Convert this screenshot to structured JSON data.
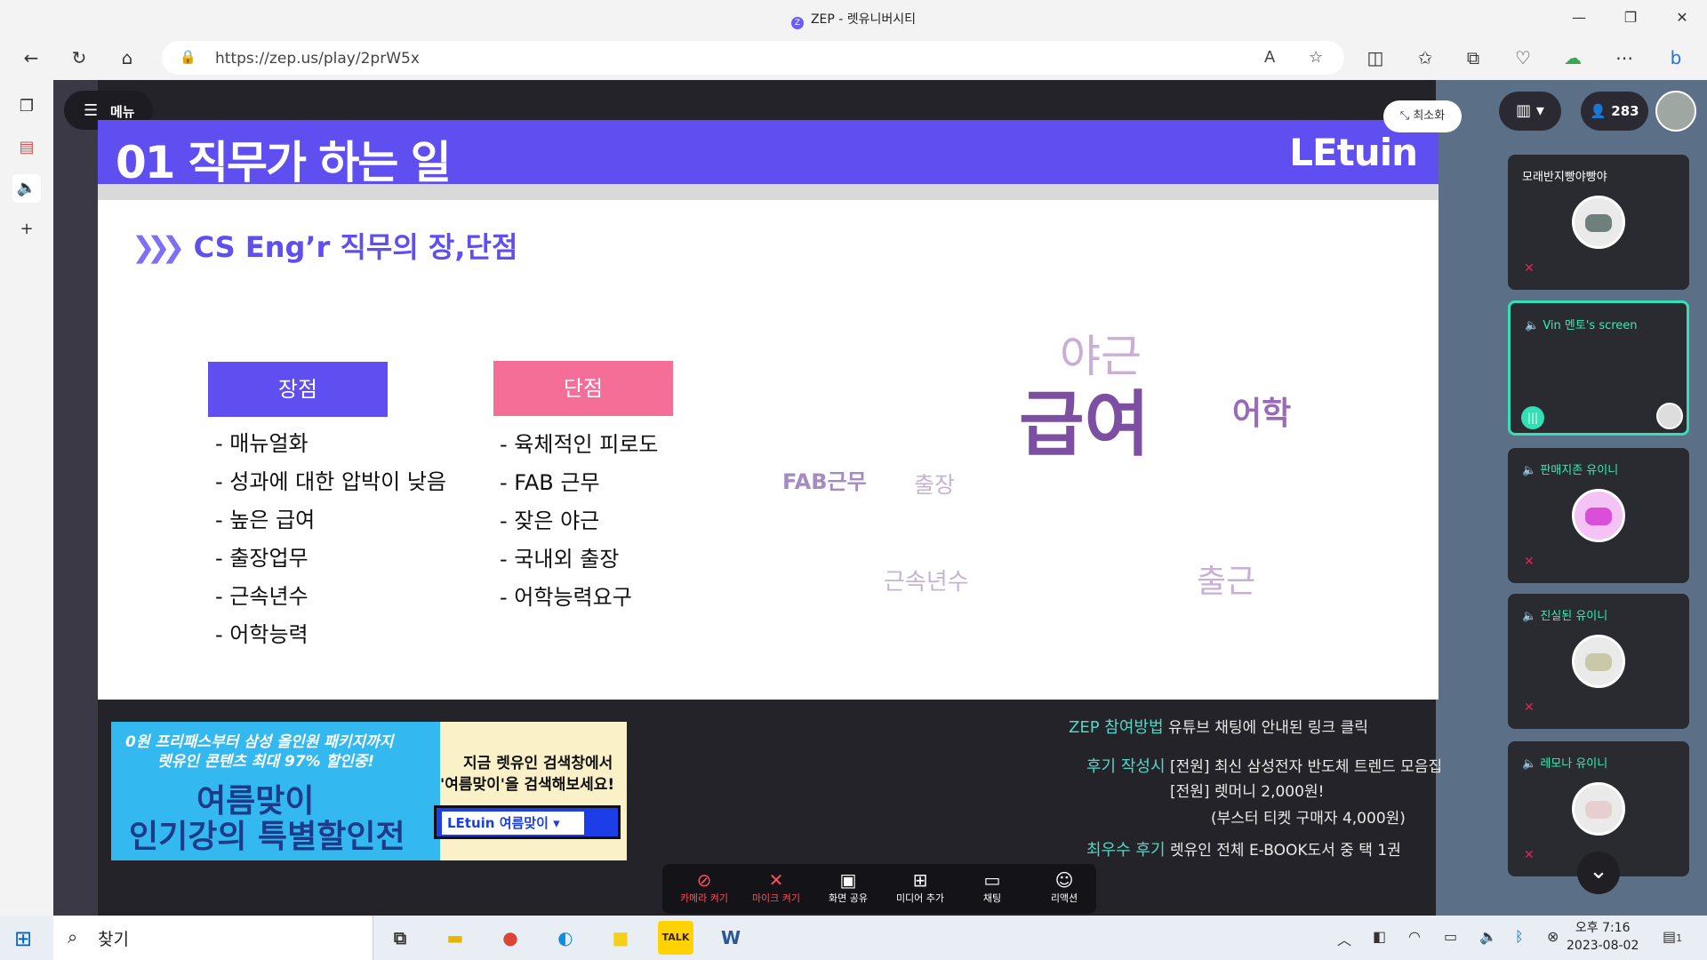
{
  "window": {
    "title": "ZEP - 렛유니버시티",
    "logo_letter": "Z"
  },
  "address_bar": {
    "url": "https://zep.us/play/2prW5x"
  },
  "zep": {
    "menu_label": "메뉴",
    "minimize_label": "최소화",
    "participant_count": "283"
  },
  "slide": {
    "number_title": "01 직무가 하는 일",
    "brand": "LEtuin",
    "section_title": "CS Eng’r 직무의 장,단점",
    "pros": {
      "label": "장점",
      "items": [
        "- 매뉴얼화",
        "- 성과에 대한 압박이 낮음",
        "- 높은 급여",
        "- 출장업무",
        "- 근속년수",
        "- 어학능력"
      ]
    },
    "cons": {
      "label": "단점",
      "items": [
        "- 육체적인 피로도",
        "- FAB 근무",
        "- 잦은 야근",
        "- 국내외 출장",
        "- 어학능력요구"
      ]
    },
    "word_cloud": [
      {
        "text": "야근",
        "color": "#c9aed6"
      },
      {
        "text": "급여",
        "color": "#7d4fa3"
      },
      {
        "text": "어학",
        "color": "#9a6ab8"
      },
      {
        "text": "FAB근무",
        "color": "#a58bc4"
      },
      {
        "text": "출장",
        "color": "#c6b4d6"
      },
      {
        "text": "근속년수",
        "color": "#c6b4d6"
      },
      {
        "text": "출근",
        "color": "#c9aed6"
      }
    ]
  },
  "banner": {
    "line1": "0원 프리패스부터 삼성 올인원 패키지까지",
    "line2": "렛유인 콘텐츠 최대 97% 할인중!",
    "big1": "여름맞이",
    "big2": "인기강의 특별할인전",
    "right1": "지금 렛유인 검색창에서",
    "right2": "'여름맞이'을 검색해보세요!",
    "search_text": "LEtuin  여름맞이 ▾"
  },
  "info": {
    "zep_key": "ZEP 참여방법",
    "zep_val": "유튜브 채팅에 안내된 링크 클릭",
    "review_key": "후기 작성시",
    "review_val1": "[전원] 최신 삼성전자 반도체 트렌드 모음집",
    "review_val2": "[전원] 렛머니 2,000원!",
    "review_val3": "(부스터 티켓 구매자 4,000원)",
    "best_key": "최우수 후기",
    "best_val": "렛유인 전체 E-BOOK도서 중 택 1권"
  },
  "controls": [
    {
      "label": "카메라 켜기",
      "icon": "camera-off-icon",
      "glyph": "⊘",
      "off": true
    },
    {
      "label": "마이크 켜기",
      "icon": "mic-off-icon",
      "glyph": "✕",
      "off": true
    },
    {
      "label": "화면 공유",
      "icon": "screen-share-icon",
      "glyph": "▣",
      "off": false
    },
    {
      "label": "미디어 추가",
      "icon": "media-add-icon",
      "glyph": "⊞",
      "off": false
    },
    {
      "label": "채팅",
      "icon": "chat-icon",
      "glyph": "▭",
      "off": false
    },
    {
      "label": "리액션",
      "icon": "reaction-icon",
      "glyph": "☺",
      "off": false
    }
  ],
  "participants": [
    {
      "name": "모래반지빵야빵야",
      "active": false,
      "muted": true
    },
    {
      "name": "Vin 멘토's screen",
      "active": true,
      "muted": false
    },
    {
      "name": "판매지존 유이니",
      "active": false,
      "muted": true
    },
    {
      "name": "진실된 유이니",
      "active": false,
      "muted": true
    },
    {
      "name": "레모나 유이니",
      "active": false,
      "muted": true
    }
  ],
  "taskbar": {
    "search_text": "찾기",
    "apps": [
      {
        "name": "task-view-icon",
        "glyph": "⧉",
        "color": "#333"
      },
      {
        "name": "file-explorer-icon",
        "glyph": "▬",
        "color": "#e8b400"
      },
      {
        "name": "chrome-icon",
        "glyph": "●",
        "color": "#db4437"
      },
      {
        "name": "edge-icon",
        "glyph": "◐",
        "color": "#0e8de0"
      },
      {
        "name": "sticky-notes-icon",
        "glyph": "■",
        "color": "#f4d01b"
      },
      {
        "name": "kakaotalk-icon",
        "glyph": "TALK",
        "color": "#3b1e1e"
      },
      {
        "name": "word-icon",
        "glyph": "W",
        "color": "#2b579a"
      }
    ],
    "time": "오후 7:16",
    "date": "2023-08-02",
    "notification_count": "1"
  },
  "colors": {
    "accent": "#5f4ef0",
    "pros": "#5f4ef0",
    "cons": "#f56e97",
    "teal": "#33e0b5"
  }
}
